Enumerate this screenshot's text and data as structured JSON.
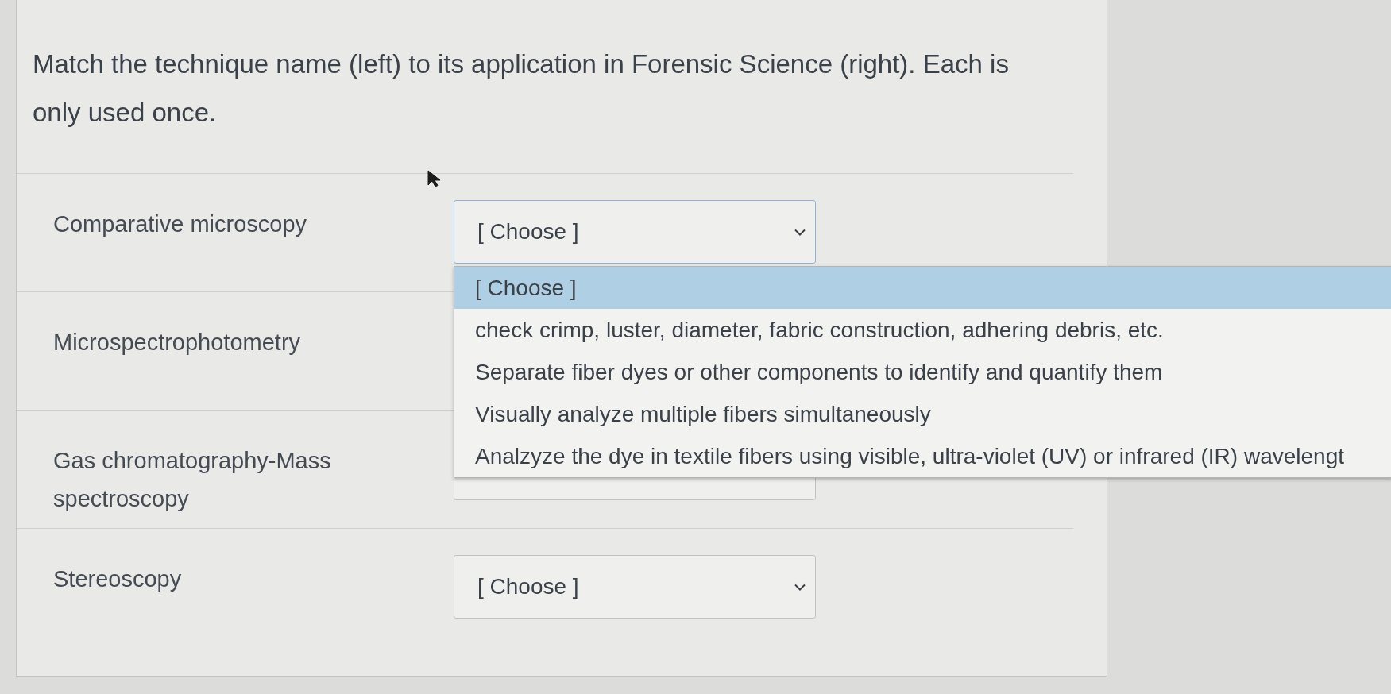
{
  "question": {
    "text": "Match the technique name (left) to its application in Forensic Science (right). Each is only used once."
  },
  "matches": [
    {
      "term": "Comparative microscopy",
      "select": {
        "value": "[ Choose ]",
        "expanded": true,
        "options": [
          {
            "label": "[ Choose ]",
            "selected": true
          },
          {
            "label": "check crimp, luster, diameter, fabric construction, adhering debris, etc.",
            "selected": false
          },
          {
            "label": "Separate fiber dyes or other components to identify and quantify them",
            "selected": false
          },
          {
            "label": "Visually analyze multiple fibers simultaneously",
            "selected": false
          },
          {
            "label": "Analzyze the dye in textile fibers using visible, ultra-violet (UV) or infrared (IR) wavelengt",
            "selected": false
          }
        ]
      }
    },
    {
      "term": "Microspectrophotometry"
    },
    {
      "term": "Gas chromatography-Mass spectroscopy",
      "select": {
        "expanded": false
      }
    },
    {
      "term": "Stereoscopy",
      "select": {
        "value": "[ Choose ]",
        "expanded": false
      }
    }
  ]
}
